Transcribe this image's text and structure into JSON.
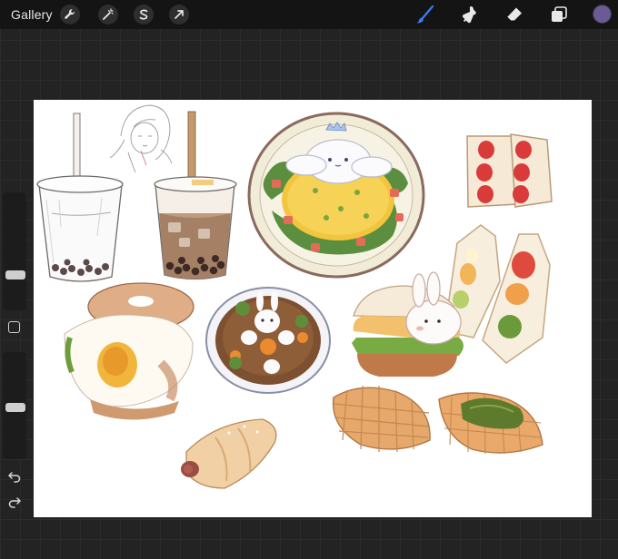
{
  "toolbar": {
    "gallery_label": "Gallery",
    "left_tools": [
      "wrench-icon",
      "magic-wand-icon",
      "selection-icon",
      "transform-arrow-icon"
    ],
    "right_tools": [
      "brush-icon",
      "smudge-icon",
      "eraser-icon",
      "layers-icon"
    ],
    "active_tool": "brush-icon",
    "active_color": "#6b5a93",
    "accent_color": "#3d7bf6"
  },
  "sidebar": {
    "controls": [
      "brush-size-slider",
      "modify-button",
      "opacity-slider",
      "undo-icon",
      "redo-icon"
    ]
  },
  "canvas": {
    "background": "#ffffff",
    "artwork": [
      "bubble-tea-sketch",
      "girl-sketch",
      "bubble-tea-milk",
      "omurice-plate",
      "strawberry-sandwich",
      "fruit-sandwiches",
      "bagel-egg-sandwich",
      "bunny-curry-bowl",
      "bunny-burger",
      "waffle-plain",
      "waffle-greens",
      "sausage-roll"
    ]
  }
}
